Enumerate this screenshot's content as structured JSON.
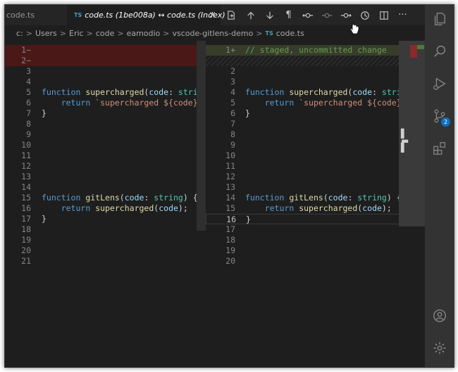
{
  "tabs": [
    {
      "label": "code.ts",
      "active": false
    },
    {
      "label": "code.ts (1be008a) ↔ code.ts (Index)",
      "active": true,
      "close": "×"
    }
  ],
  "toolbar": {
    "icons": [
      "open-file-icon",
      "arrow-up-icon",
      "arrow-down-icon",
      "pilcrow-icon",
      "git-commit-icon",
      "git-commit-dim-icon",
      "git-commit-next-icon",
      "history-icon",
      "split-editor-icon",
      "more-icon"
    ],
    "more_label": "···",
    "pilcrow": "¶"
  },
  "breadcrumb": {
    "items": [
      "c:",
      "Users",
      "Eric",
      "code",
      "eamodio",
      "vscode-gitlens-demo"
    ],
    "file_badge": "TS",
    "file": "code.ts",
    "separator": ">"
  },
  "tab_badge": "TS",
  "left_editor": {
    "lines": [
      {
        "n": "1−",
        "type": "del",
        "code": ""
      },
      {
        "n": "2−",
        "type": "del",
        "code": ""
      },
      {
        "n": "3",
        "code": ""
      },
      {
        "n": "4",
        "code": ""
      },
      {
        "n": "5",
        "code": "function supercharged(code: string"
      },
      {
        "n": "6",
        "code": "    return `supercharged ${code}`;"
      },
      {
        "n": "7",
        "code": "}"
      },
      {
        "n": "8",
        "code": ""
      },
      {
        "n": "9",
        "code": ""
      },
      {
        "n": "10",
        "code": ""
      },
      {
        "n": "11",
        "code": ""
      },
      {
        "n": "12",
        "code": ""
      },
      {
        "n": "13",
        "code": ""
      },
      {
        "n": "14",
        "code": ""
      },
      {
        "n": "15",
        "code": "function gitLens(code: string) {"
      },
      {
        "n": "16",
        "code": "    return supercharged(code);"
      },
      {
        "n": "17",
        "code": "}"
      },
      {
        "n": "18",
        "code": ""
      },
      {
        "n": "19",
        "code": ""
      },
      {
        "n": "20",
        "code": ""
      },
      {
        "n": "21",
        "code": ""
      }
    ]
  },
  "right_editor": {
    "lines": [
      {
        "n": "1+",
        "type": "add",
        "code": "// staged, uncommitted change"
      },
      {
        "n": "",
        "type": "hatch",
        "code": ""
      },
      {
        "n": "2",
        "code": ""
      },
      {
        "n": "3",
        "code": ""
      },
      {
        "n": "4",
        "code": "function supercharged(code: string"
      },
      {
        "n": "5",
        "code": "    return `supercharged ${code}`;"
      },
      {
        "n": "6",
        "code": "}"
      },
      {
        "n": "7",
        "code": ""
      },
      {
        "n": "8",
        "code": ""
      },
      {
        "n": "9",
        "code": ""
      },
      {
        "n": "10",
        "code": ""
      },
      {
        "n": "11",
        "code": ""
      },
      {
        "n": "12",
        "code": ""
      },
      {
        "n": "13",
        "code": ""
      },
      {
        "n": "14",
        "code": "function gitLens(code: string) {"
      },
      {
        "n": "15",
        "code": "    return supercharged(code);"
      },
      {
        "n": "16",
        "type": "current",
        "code": "}"
      },
      {
        "n": "17",
        "code": ""
      },
      {
        "n": "18",
        "code": ""
      },
      {
        "n": "19",
        "code": ""
      },
      {
        "n": "20",
        "code": ""
      }
    ]
  },
  "activity_bar": {
    "items": [
      "explorer-icon",
      "search-icon",
      "run-debug-icon",
      "source-control-icon",
      "extensions-icon"
    ],
    "scm_badge": "2",
    "bottom": [
      "account-icon",
      "settings-gear-icon"
    ]
  },
  "colors": {
    "deleted_bg": "#4b1818",
    "added_bg": "#373d29",
    "keyword": "#569cd6",
    "function": "#dcdcaa",
    "param": "#9cdcfe",
    "type": "#4ec9b0",
    "string": "#ce9178",
    "comment": "#6a9955"
  }
}
